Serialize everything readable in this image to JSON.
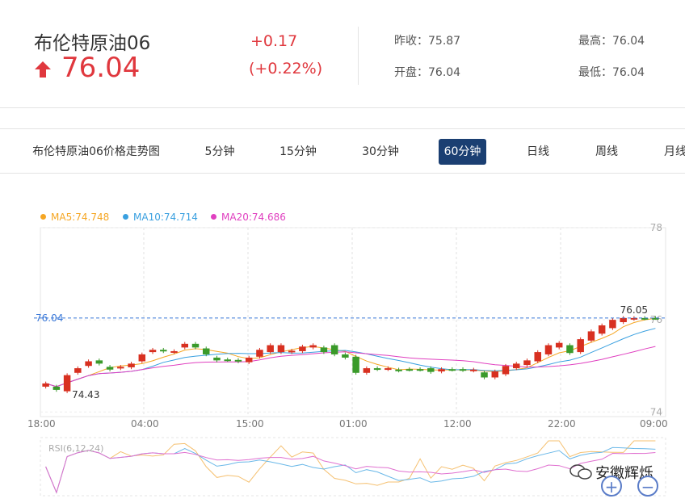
{
  "header": {
    "title": "布伦特原油06",
    "price": "76.04",
    "change": "+0.17",
    "change_pct": "(+0.22%)",
    "stats": {
      "prev_close_label": "昨收：",
      "prev_close": "75.87",
      "open_label": "开盘：",
      "open": "76.04",
      "high_label": "最高：",
      "high": "76.04",
      "low_label": "最低：",
      "low": "76.04"
    },
    "up_color": "#e0383e"
  },
  "tabs": {
    "chart_label": "布伦特原油06价格走势图",
    "items": [
      "5分钟",
      "15分钟",
      "30分钟",
      "60分钟",
      "日线",
      "周线",
      "月线"
    ],
    "active": "60分钟"
  },
  "legend": {
    "ma5": "MA5:74.748",
    "ma10": "MA10:74.714",
    "ma20": "MA20:74.686",
    "ma5_color": "#f5a623",
    "ma10_color": "#3aa0e0",
    "ma20_color": "#e040c0"
  },
  "chart_data": {
    "type": "candlestick",
    "ylim": [
      73.9,
      78.0
    ],
    "y_ticks": [
      "78",
      "76",
      "74"
    ],
    "x_ticks": [
      "18:00",
      "04:00",
      "15:00",
      "01:00",
      "12:00",
      "22:00",
      "09:00"
    ],
    "current_line": "76.04",
    "max_label": "76.05",
    "min_label": "74.43",
    "candles": [
      {
        "o": 74.55,
        "c": 74.62
      },
      {
        "o": 74.55,
        "c": 74.48
      },
      {
        "o": 74.45,
        "c": 74.8
      },
      {
        "o": 74.85,
        "c": 74.95
      },
      {
        "o": 75.0,
        "c": 75.1
      },
      {
        "o": 75.12,
        "c": 75.05
      },
      {
        "o": 74.98,
        "c": 74.92
      },
      {
        "o": 74.95,
        "c": 74.98
      },
      {
        "o": 74.97,
        "c": 75.05
      },
      {
        "o": 75.1,
        "c": 75.25
      },
      {
        "o": 75.3,
        "c": 75.35
      },
      {
        "o": 75.35,
        "c": 75.32
      },
      {
        "o": 75.3,
        "c": 75.32
      },
      {
        "o": 75.4,
        "c": 75.48
      },
      {
        "o": 75.48,
        "c": 75.4
      },
      {
        "o": 75.38,
        "c": 75.25
      },
      {
        "o": 75.18,
        "c": 75.12
      },
      {
        "o": 75.13,
        "c": 75.14
      },
      {
        "o": 75.13,
        "c": 75.1
      },
      {
        "o": 75.08,
        "c": 75.18
      },
      {
        "o": 75.2,
        "c": 75.35
      },
      {
        "o": 75.3,
        "c": 75.45
      },
      {
        "o": 75.3,
        "c": 75.45
      },
      {
        "o": 75.3,
        "c": 75.33
      },
      {
        "o": 75.32,
        "c": 75.42
      },
      {
        "o": 75.4,
        "c": 75.45
      },
      {
        "o": 75.4,
        "c": 75.3
      },
      {
        "o": 75.45,
        "c": 75.25
      },
      {
        "o": 75.25,
        "c": 75.18
      },
      {
        "o": 75.2,
        "c": 74.85
      },
      {
        "o": 74.85,
        "c": 74.95
      },
      {
        "o": 74.95,
        "c": 74.93
      },
      {
        "o": 74.93,
        "c": 74.95
      },
      {
        "o": 74.92,
        "c": 74.9
      },
      {
        "o": 74.92,
        "c": 74.93
      },
      {
        "o": 74.93,
        "c": 74.92
      },
      {
        "o": 74.95,
        "c": 74.87
      },
      {
        "o": 74.88,
        "c": 74.93
      },
      {
        "o": 74.92,
        "c": 74.93
      },
      {
        "o": 74.93,
        "c": 74.91
      },
      {
        "o": 74.9,
        "c": 74.92
      },
      {
        "o": 74.86,
        "c": 74.75
      },
      {
        "o": 74.75,
        "c": 74.88
      },
      {
        "o": 74.82,
        "c": 75.0
      },
      {
        "o": 74.95,
        "c": 75.05
      },
      {
        "o": 75.02,
        "c": 75.12
      },
      {
        "o": 75.1,
        "c": 75.3
      },
      {
        "o": 75.25,
        "c": 75.45
      },
      {
        "o": 75.4,
        "c": 75.5
      },
      {
        "o": 75.45,
        "c": 75.28
      },
      {
        "o": 75.3,
        "c": 75.58
      },
      {
        "o": 75.55,
        "c": 75.75
      },
      {
        "o": 75.7,
        "c": 75.88
      },
      {
        "o": 75.82,
        "c": 76.0
      },
      {
        "o": 75.95,
        "c": 76.04
      },
      {
        "o": 76.02,
        "c": 76.04
      },
      {
        "o": 76.03,
        "c": 76.04
      },
      {
        "o": 76.04,
        "c": 76.04
      }
    ],
    "rsi_label": "RSI(6,12,24)"
  },
  "zoom": {
    "in_label": "+",
    "out_label": "−"
  },
  "watermark": "安徽辉烁"
}
